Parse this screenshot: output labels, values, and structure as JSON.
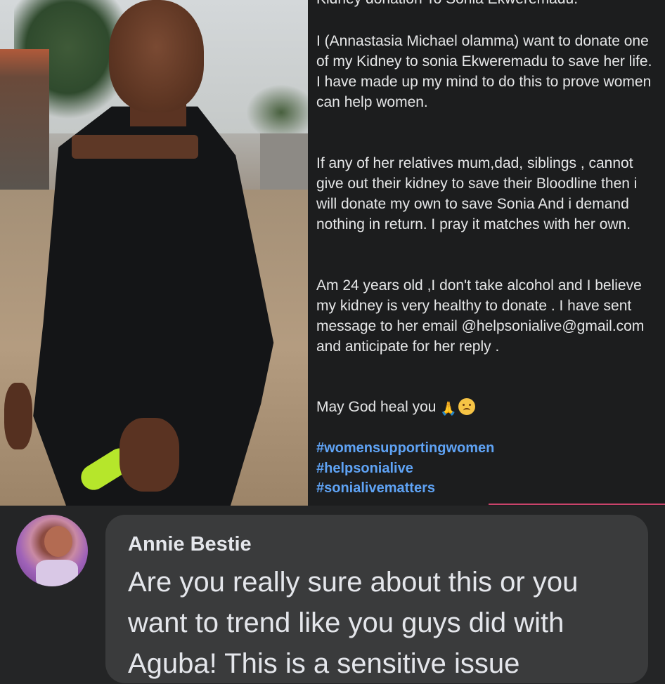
{
  "post": {
    "heading_partial": "Kidney donation To Sonia Ekweremadu.",
    "paragraph_1": "I (Annastasia Michael olamma) want to donate one of my Kidney to sonia Ekweremadu to save her life. I have made up my mind to do this to prove women can help women.",
    "paragraph_2": "If any of her relatives mum,dad, siblings , cannot give out their kidney to save their Bloodline then i will donate my own to save Sonia And i demand nothing in return. I pray it matches with her own.",
    "paragraph_3": "Am 24 years old ,I don't take alcohol and  I believe my kidney is very healthy to donate . I have sent message to her email @helpsonialive@gmail.com and anticipate for her reply .",
    "paragraph_4": "May God heal you",
    "emoji_1": "🙏",
    "hashtags": [
      "#womensupportingwomen",
      "#helpsonialive",
      "#sonialivematters"
    ]
  },
  "comment": {
    "author": "Annie Bestie",
    "text": "Are you really sure about this or you want to trend like you guys did with Aguba! This is a sensitive issue"
  },
  "colors": {
    "background": "#242526",
    "bubble": "#3a3b3c",
    "hashtag": "#5fa3f5",
    "text": "#e4e6eb"
  }
}
